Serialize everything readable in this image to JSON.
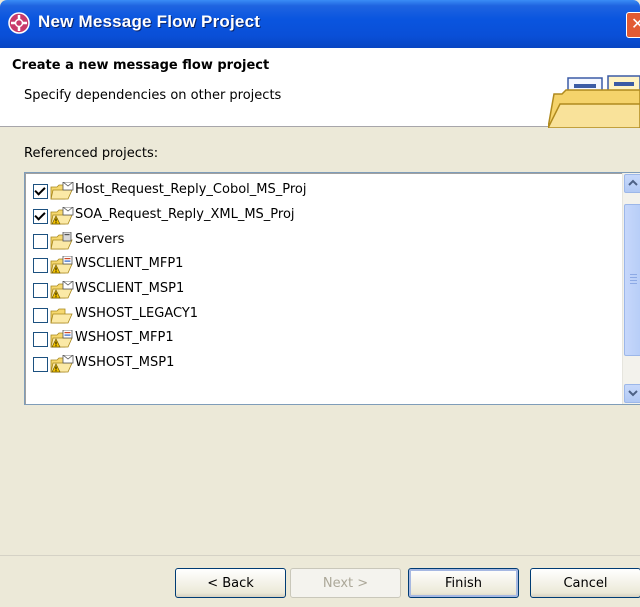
{
  "window": {
    "title": "New Message Flow Project",
    "close_glyph": "✕"
  },
  "header": {
    "title": "Create a new message flow project",
    "subtitle": "Specify dependencies on other projects",
    "graphic": "folder-wizard-graphic"
  },
  "referenced": {
    "label": "Referenced projects:",
    "items": [
      {
        "label": "Host_Request_Reply_Cobol_MS_Proj",
        "checked": true,
        "icon": "message-set-project-icon"
      },
      {
        "label": "SOA_Request_Reply_XML_MS_Proj",
        "checked": true,
        "icon": "message-set-project-warning-icon"
      },
      {
        "label": "Servers",
        "checked": false,
        "icon": "server-project-icon"
      },
      {
        "label": "WSCLIENT_MFP1",
        "checked": false,
        "icon": "flow-project-warning-icon"
      },
      {
        "label": "WSCLIENT_MSP1",
        "checked": false,
        "icon": "message-set-project-warning-icon"
      },
      {
        "label": "WSHOST_LEGACY1",
        "checked": false,
        "icon": "folder-project-icon"
      },
      {
        "label": "WSHOST_MFP1",
        "checked": false,
        "icon": "flow-project-warning-icon"
      },
      {
        "label": "WSHOST_MSP1",
        "checked": false,
        "icon": "message-set-project-warning-icon"
      }
    ]
  },
  "buttons": {
    "back": "< Back",
    "next": "Next >",
    "finish": "Finish",
    "cancel": "Cancel"
  },
  "colors": {
    "titlebar": "#0a55df",
    "dialog_bg": "#ece9d8",
    "list_border": "#7f9db9"
  }
}
